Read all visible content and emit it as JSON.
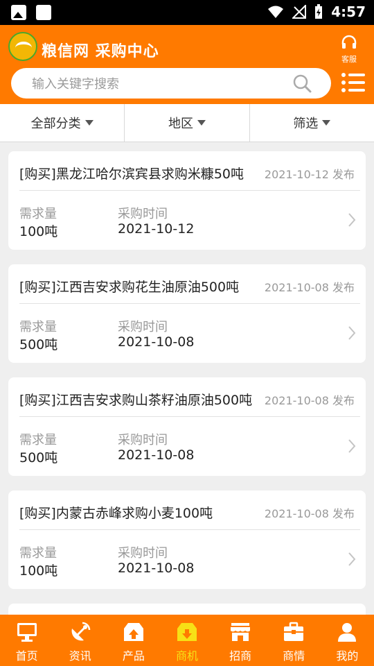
{
  "status_bar": {
    "time": "4:57"
  },
  "header": {
    "title": "粮信网 采购中心",
    "service_label": "客服",
    "search_placeholder": "输入关键字搜索"
  },
  "filters": [
    {
      "label": "全部分类"
    },
    {
      "label": "地区"
    },
    {
      "label": "筛选"
    }
  ],
  "cards": [
    {
      "title": "[购买]黑龙江哈尔滨宾县求购米糠50吨",
      "posted": "2021-10-12 发布",
      "qty_label": "需求量",
      "qty": "100吨",
      "time_label": "采购时间",
      "time": "2021-10-12"
    },
    {
      "title": "[购买]江西吉安求购花生油原油500吨",
      "posted": "2021-10-08 发布",
      "qty_label": "需求量",
      "qty": "500吨",
      "time_label": "采购时间",
      "time": "2021-10-08"
    },
    {
      "title": "[购买]江西吉安求购山茶籽油原油500吨",
      "posted": "2021-10-08 发布",
      "qty_label": "需求量",
      "qty": "500吨",
      "time_label": "采购时间",
      "time": "2021-10-08"
    },
    {
      "title": "[购买]内蒙古赤峰求购小麦100吨",
      "posted": "2021-10-08 发布",
      "qty_label": "需求量",
      "qty": "100吨",
      "time_label": "采购时间",
      "time": "2021-10-08"
    }
  ],
  "tabs": [
    {
      "label": "首页",
      "icon": "monitor-icon"
    },
    {
      "label": "资讯",
      "icon": "satellite-icon"
    },
    {
      "label": "产品",
      "icon": "upload-box-icon"
    },
    {
      "label": "商机",
      "icon": "download-box-icon"
    },
    {
      "label": "招商",
      "icon": "store-icon"
    },
    {
      "label": "商情",
      "icon": "briefcase-icon"
    },
    {
      "label": "我的",
      "icon": "person-icon"
    }
  ],
  "active_tab": "商机",
  "colors": {
    "brand": "#ff7a00",
    "active_tab_text": "#f7e016"
  }
}
